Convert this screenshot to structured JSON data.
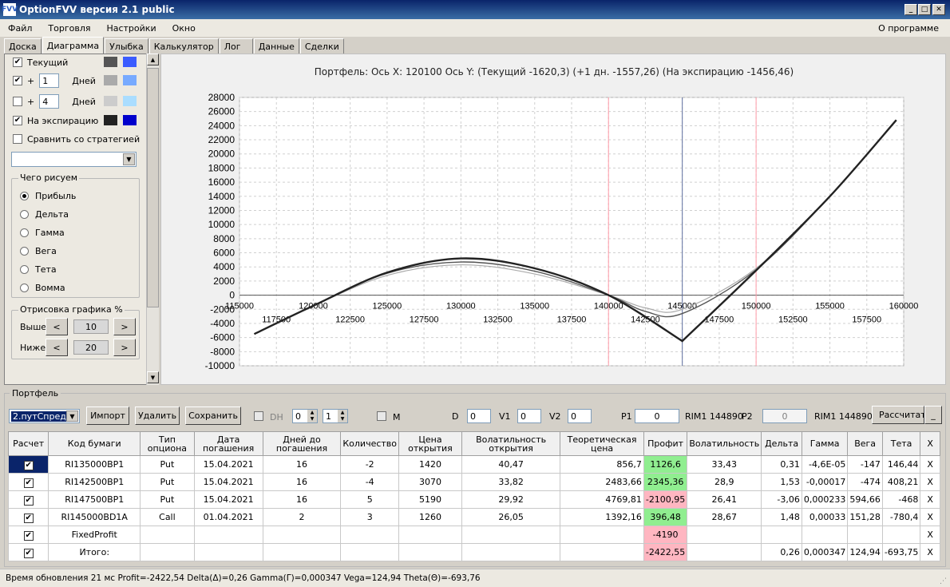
{
  "window": {
    "title": "OptionFVV версия 2.1 public",
    "icon": "FVV"
  },
  "menu": {
    "file": "Файл",
    "trade": "Торговля",
    "settings": "Настройки",
    "window": "Окно",
    "about": "О программе"
  },
  "tabs": [
    "Доска",
    "Диаграмма",
    "Улыбка",
    "Калькулятор",
    "Лог",
    "Данные",
    "Сделки"
  ],
  "left": {
    "current": "Текущий",
    "plus": "+",
    "days": "Дней",
    "d1": "1",
    "d2": "4",
    "expiry": "На экспирацию",
    "compare": "Сравнить со стратегией",
    "what_title": "Чего рисуем",
    "radios": [
      "Прибыль",
      "Дельта",
      "Гамма",
      "Вега",
      "Тета",
      "Вомма"
    ],
    "draw_title": "Отрисовка графика %",
    "above": "Выше",
    "below": "Ниже",
    "above_val": "10",
    "below_val": "20",
    "lt": "<",
    "gt": ">",
    "colors": {
      "cur1": "#555555",
      "cur2": "#3b5cff",
      "p1a": "#aaaaaa",
      "p1b": "#77aaff",
      "p4a": "#cccccc",
      "p4b": "#aaddff",
      "exp1": "#222222",
      "exp2": "#0000cc"
    }
  },
  "chart_header": "Портфель: Ось X: 120100 Ось Y:  (Текущий -1620,3)  (+1 дн. -1557,26)  (На экспирацию -1456,46)",
  "chart_data": {
    "type": "line",
    "ylim": [
      -10000,
      28000
    ],
    "xlim": [
      115000,
      160000
    ],
    "yticks": [
      "28000",
      "26000",
      "24000",
      "22000",
      "20000",
      "18000",
      "16000",
      "14000",
      "12000",
      "10000",
      "8000",
      "6000",
      "4000",
      "2000",
      "0",
      "-2000",
      "-4000",
      "-6000",
      "-8000",
      "-10000"
    ],
    "xticks_upper": [
      "115000",
      "120000",
      "125000",
      "130000",
      "135000",
      "140000",
      "145000",
      "150000",
      "155000",
      "160000"
    ],
    "xticks_lower": [
      "117500",
      "122500",
      "127500",
      "132500",
      "137500",
      "142500",
      "147500",
      "152500",
      "157500"
    ],
    "vlines": {
      "pink": [
        140000,
        150000
      ],
      "gray": 145000
    },
    "series": [
      {
        "color": "#222222",
        "x": [
          116000,
          120000,
          125000,
          130000,
          135000,
          140000,
          145000,
          150000,
          155000,
          159500
        ],
        "y": [
          -5500,
          -1500,
          3200,
          5200,
          3800,
          0,
          -6500,
          3500,
          14000,
          24800
        ]
      },
      {
        "color": "#555555",
        "x": [
          116000,
          120000,
          125000,
          130000,
          135000,
          140000,
          142500,
          145000,
          150000,
          155000,
          159500
        ],
        "y": [
          -5500,
          -1500,
          3100,
          4700,
          3400,
          0,
          -2300,
          -2600,
          3600,
          14000,
          24800
        ]
      },
      {
        "color": "#aaaaaa",
        "x": [
          116000,
          120000,
          125000,
          130000,
          135000,
          140000,
          142500,
          145000,
          150000,
          155000,
          159500
        ],
        "y": [
          -5500,
          -1500,
          2800,
          4300,
          3000,
          0,
          -1800,
          -2000,
          3800,
          14000,
          24800
        ]
      }
    ]
  },
  "portfolio": {
    "label": "Портфель",
    "select": "2.путСпред",
    "import": "Импорт",
    "delete": "Удалить",
    "save": "Сохранить",
    "dh": "DH",
    "m": "M",
    "spin1": "0",
    "spin2": "1",
    "d": "D",
    "d_val": "0",
    "v1": "V1",
    "v1_val": "0",
    "v2": "V2",
    "v2_val": "0",
    "p1": "P1",
    "p1_val": "0",
    "rim1a": "RIM1 144890",
    "p2": "P2",
    "p2_val": "0",
    "rim1b": "RIM1 144890",
    "calc": "Рассчитать",
    "minimize": "_"
  },
  "table": {
    "headers": [
      "Расчет",
      "Код бумаги",
      "Тип опциона",
      "Дата погашения",
      "Дней до погашения",
      "Количество",
      "Цена открытия",
      "Волатильность открытия",
      "Теоретическая цена",
      "Профит",
      "Волатильность",
      "Дельта",
      "Гамма",
      "Вега",
      "Тета",
      "X"
    ],
    "rows": [
      {
        "code": "RI135000BP1",
        "type": "Put",
        "date": "15.04.2021",
        "days": "16",
        "qty": "-2",
        "price": "1420",
        "vol": "40,47",
        "theo": "856,7",
        "profit": "1126,6",
        "pc": "green",
        "v": "33,43",
        "delta": "0,31",
        "gamma": "-4,6E-05",
        "vega": "-147",
        "theta": "146,44",
        "x": "X"
      },
      {
        "code": "RI142500BP1",
        "type": "Put",
        "date": "15.04.2021",
        "days": "16",
        "qty": "-4",
        "price": "3070",
        "vol": "33,82",
        "theo": "2483,66",
        "profit": "2345,36",
        "pc": "green",
        "v": "28,9",
        "delta": "1,53",
        "gamma": "-0,00017",
        "vega": "-474",
        "theta": "408,21",
        "x": "X"
      },
      {
        "code": "RI147500BP1",
        "type": "Put",
        "date": "15.04.2021",
        "days": "16",
        "qty": "5",
        "price": "5190",
        "vol": "29,92",
        "theo": "4769,81",
        "profit": "-2100,95",
        "pc": "pink",
        "v": "26,41",
        "delta": "-3,06",
        "gamma": "0,000233",
        "vega": "594,66",
        "theta": "-468",
        "x": "X"
      },
      {
        "code": "RI145000BD1A",
        "type": "Call",
        "date": "01.04.2021",
        "days": "2",
        "qty": "3",
        "price": "1260",
        "vol": "26,05",
        "theo": "1392,16",
        "profit": "396,48",
        "pc": "green",
        "v": "28,67",
        "delta": "1,48",
        "gamma": "0,00033",
        "vega": "151,28",
        "theta": "-780,4",
        "x": "X"
      },
      {
        "code": "FixedProfit",
        "type": "",
        "date": "",
        "days": "",
        "qty": "",
        "price": "",
        "vol": "",
        "theo": "",
        "profit": "-4190",
        "pc": "pink",
        "v": "",
        "delta": "",
        "gamma": "",
        "vega": "",
        "theta": "",
        "x": "X"
      },
      {
        "code": "Итого:",
        "type": "",
        "date": "",
        "days": "",
        "qty": "",
        "price": "",
        "vol": "",
        "theo": "",
        "profit": "-2422,55",
        "pc": "pink",
        "v": "",
        "delta": "0,26",
        "gamma": "0,000347",
        "vega": "124,94",
        "theta": "-693,75",
        "x": "X"
      }
    ]
  },
  "status": "Время обновления 21 мс  Profit=-2422,54 Delta(Δ)=0,26 Gamma(Γ)=0,000347 Vega=124,94 Theta(Θ)=-693,76"
}
